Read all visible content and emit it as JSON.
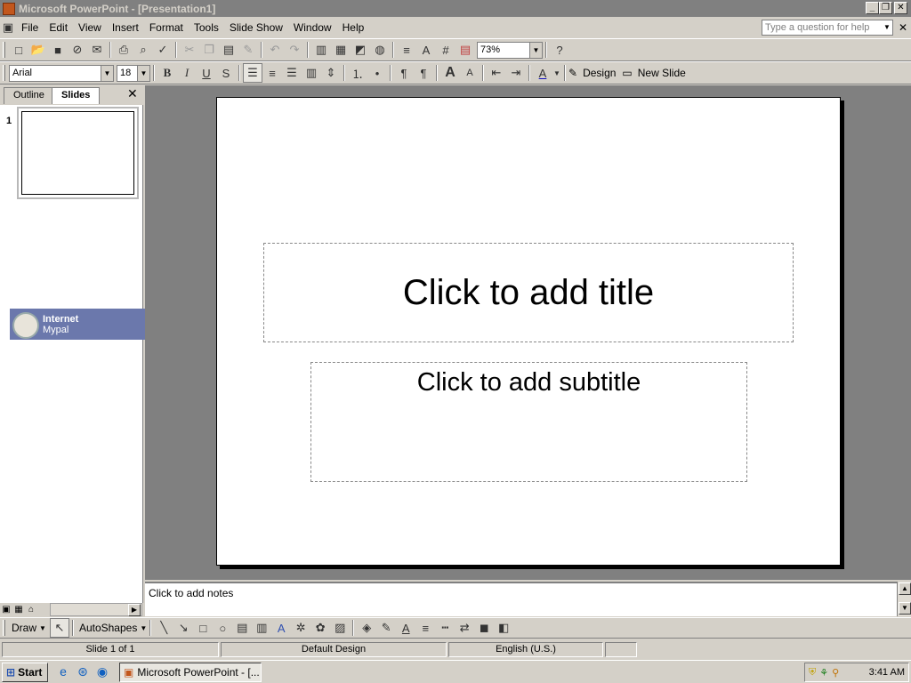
{
  "window": {
    "title": "Microsoft PowerPoint - [Presentation1]"
  },
  "menu": {
    "items": [
      {
        "label": "File"
      },
      {
        "label": "Edit"
      },
      {
        "label": "View"
      },
      {
        "label": "Insert"
      },
      {
        "label": "Format"
      },
      {
        "label": "Tools"
      },
      {
        "label": "Slide Show"
      },
      {
        "label": "Window"
      },
      {
        "label": "Help"
      }
    ],
    "ask_placeholder": "Type a question for help"
  },
  "standard_toolbar": {
    "zoom": "73%"
  },
  "formatting_toolbar": {
    "font": "Arial",
    "font_size": "18",
    "bold": "B",
    "italic": "I",
    "underline": "U",
    "shadow": "S",
    "design_label": "Design",
    "new_slide_label": "New Slide"
  },
  "left_pane": {
    "tab_outline": "Outline",
    "tab_slides": "Slides",
    "slide_number": "1"
  },
  "internet_tooltip": {
    "title": "Internet",
    "subtitle": "Mypal"
  },
  "slide": {
    "title_placeholder": "Click to add title",
    "subtitle_placeholder": "Click to add subtitle"
  },
  "notes": {
    "placeholder": "Click to add notes"
  },
  "draw_toolbar": {
    "draw_label": "Draw",
    "autoshapes_label": "AutoShapes"
  },
  "status": {
    "slide": "Slide 1 of 1",
    "design": "Default Design",
    "language": "English (U.S.)"
  },
  "taskbar": {
    "start_label": "Start",
    "task_label": "Microsoft PowerPoint - [...",
    "clock": "3:41 AM"
  },
  "colors": {
    "chrome": "#d4d0c8",
    "titlebar_inactive": "#808080",
    "tooltip_bg": "#6b78ac",
    "canvas_bg": "#808080"
  }
}
